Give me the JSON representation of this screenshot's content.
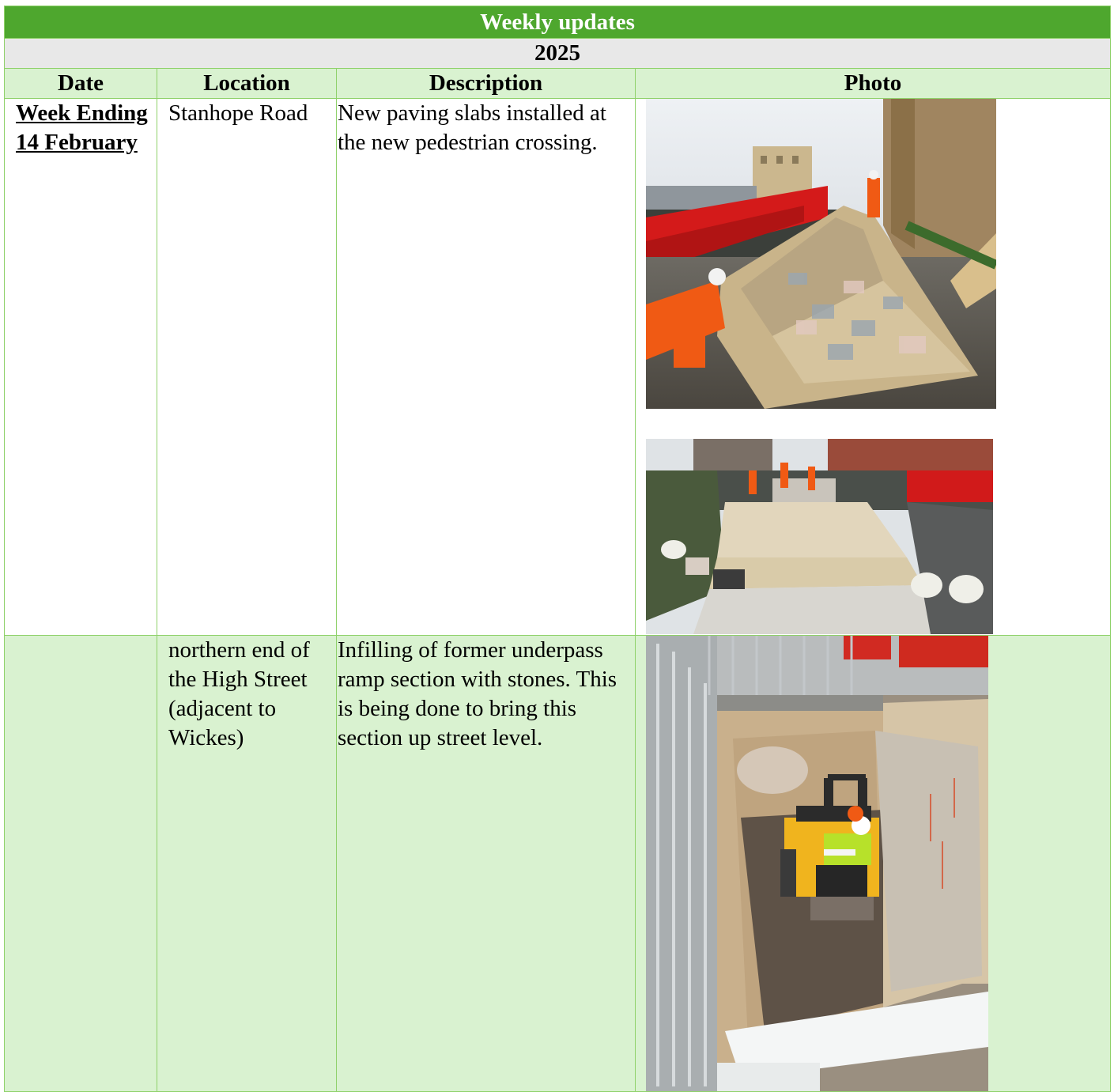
{
  "table": {
    "title": "Weekly updates",
    "year": "2025",
    "headers": [
      "Date",
      "Location",
      "Description",
      "Photo"
    ],
    "rows": [
      {
        "date": "Week Ending 14 February",
        "location": "Stanhope Road",
        "description": "New paving slabs installed at the new pedestrian crossing.",
        "photos": [
          "paving-slabs-crossing-photo",
          "paving-area-overview-photo"
        ]
      },
      {
        "date": "",
        "location": "northern end of the High Street (adjacent to Wickes)",
        "description": "Infilling of former underpass ramp section with stones. This is being done to bring this section up street level.",
        "photos": [
          "underpass-infill-roller-photo"
        ]
      }
    ]
  },
  "colors": {
    "title_bg": "#4ea72e",
    "header_bg": "#d9f2d0",
    "year_bg": "#e8e8e8",
    "border": "#8fd16a"
  }
}
